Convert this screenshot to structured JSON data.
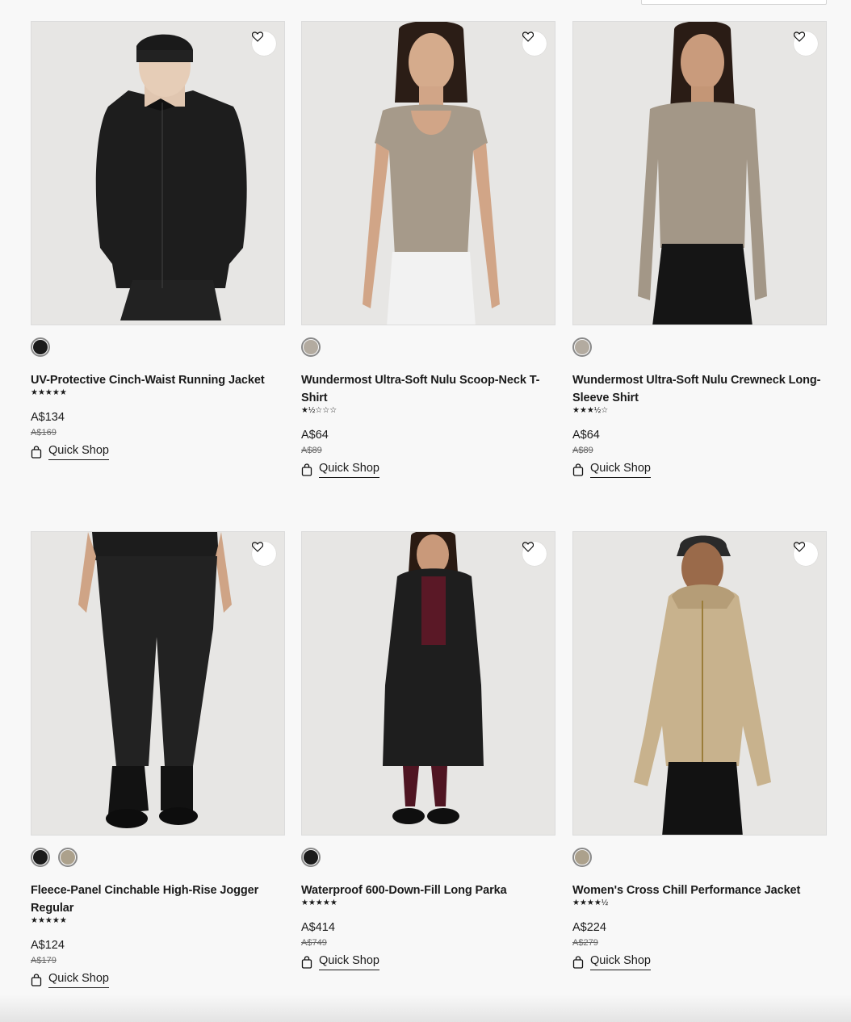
{
  "products": [
    {
      "name": "UV-Protective Cinch-Waist Running Jacket",
      "rating_stars": "★★★★★",
      "price": "A$134",
      "was_price": "A$169",
      "quick_shop": "Quick Shop",
      "swatches": [
        "#1b1b1b"
      ],
      "image": "woman-black-jacket"
    },
    {
      "name": "Wundermost Ultra-Soft Nulu Scoop-Neck T-Shirt",
      "rating_stars": "★½☆☆☆",
      "price": "A$64",
      "was_price": "A$89",
      "quick_shop": "Quick Shop",
      "swatches": [
        "#b3aba0"
      ],
      "image": "woman-taupe-tshirt"
    },
    {
      "name": "Wundermost Ultra-Soft Nulu Crewneck Long-Sleeve Shirt",
      "rating_stars": "★★★½☆",
      "price": "A$64",
      "was_price": "A$89",
      "quick_shop": "Quick Shop",
      "swatches": [
        "#b3aba0"
      ],
      "image": "woman-taupe-longsleeve"
    },
    {
      "name": "Fleece-Panel Cinchable High-Rise Jogger Regular",
      "rating_stars": "★★★★★",
      "price": "A$124",
      "was_price": "A$179",
      "quick_shop": "Quick Shop",
      "swatches": [
        "#1b1b1b",
        "#aca18c"
      ],
      "image": "black-jogger-pants"
    },
    {
      "name": "Waterproof 600-Down-Fill Long Parka",
      "rating_stars": "★★★★★",
      "price": "A$414",
      "was_price": "A$749",
      "quick_shop": "Quick Shop",
      "swatches": [
        "#1b1b1b"
      ],
      "image": "woman-black-parka"
    },
    {
      "name": "Women's Cross Chill Performance Jacket",
      "rating_stars": "★★★★½",
      "price": "A$224",
      "was_price": "A$279",
      "quick_shop": "Quick Shop",
      "swatches": [
        "#aca18c"
      ],
      "image": "woman-tan-jacket"
    }
  ],
  "colors": {
    "background": "#f8f8f8",
    "image_bg": "#e6e5e3",
    "text": "#1a1a1a"
  }
}
